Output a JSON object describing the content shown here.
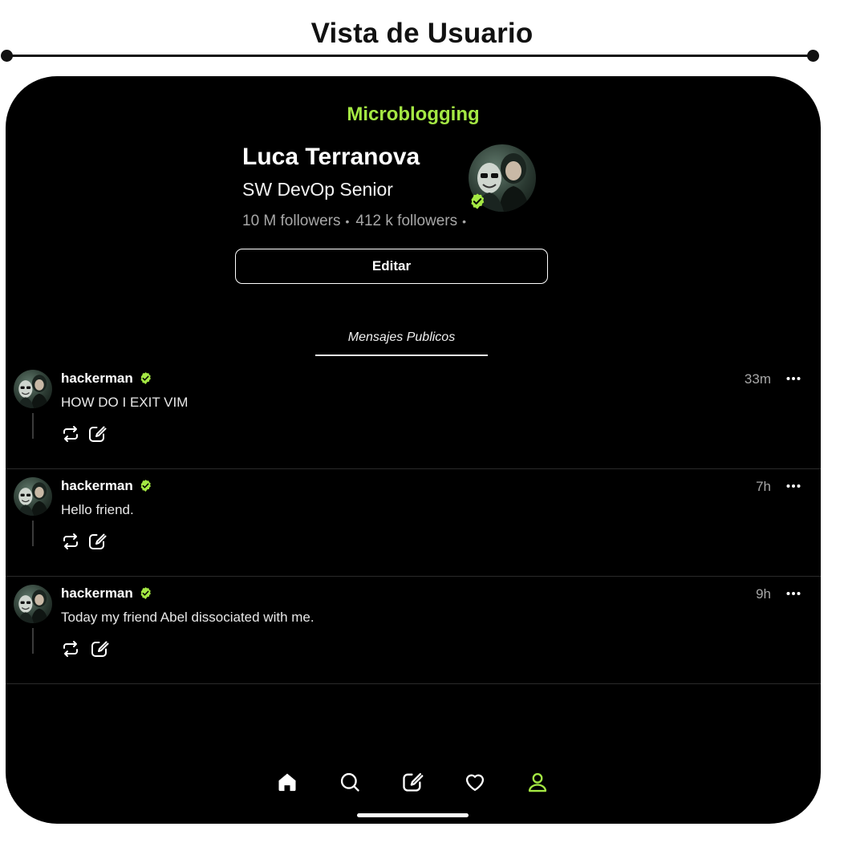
{
  "page_title": "Vista de Usuario",
  "app": {
    "brand": "Microblogging",
    "accent_color": "#a4e843"
  },
  "profile": {
    "name": "Luca Terranova",
    "role": "SW DevOp Senior",
    "followers": "10 M followers",
    "following": "412 k followers",
    "separator": "•",
    "avatar": "profile-avatar-image",
    "verified_icon": "verified-badge-icon",
    "edit_label": "Editar"
  },
  "tabs": {
    "active": "Mensajes Publicos"
  },
  "posts": [
    {
      "author": "hackerman",
      "time": "33m",
      "text": "HOW DO I EXIT VIM"
    },
    {
      "author": "hackerman",
      "time": "7h",
      "text": "Hello friend."
    },
    {
      "author": "hackerman",
      "time": "9h",
      "text": "Today my friend Abel dissociated with me."
    }
  ],
  "post_actions": [
    "repost-icon",
    "quote-icon",
    "more-icon"
  ],
  "bottom_nav": [
    {
      "icon": "home-icon",
      "active": false
    },
    {
      "icon": "search-icon",
      "active": false
    },
    {
      "icon": "compose-icon",
      "active": false
    },
    {
      "icon": "heart-icon",
      "active": false
    },
    {
      "icon": "profile-icon",
      "active": true,
      "color": "#a4e843"
    }
  ]
}
